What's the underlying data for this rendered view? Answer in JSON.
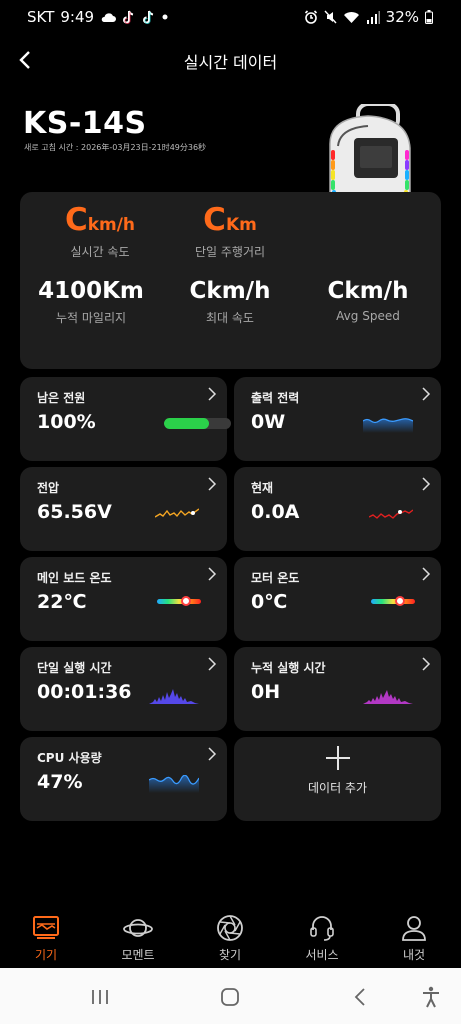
{
  "status_bar": {
    "carrier": "SKT",
    "time": "9:49",
    "battery": "32%"
  },
  "header": {
    "title": "실시간 데이터"
  },
  "device": {
    "model": "KS-14S",
    "refresh_time": "새로 고침 시간 : 2026年-03月23日-21时49分36秒"
  },
  "summary": {
    "speed": {
      "value": "C",
      "unit": "km/h",
      "label": "실시간 속도"
    },
    "trip": {
      "value": "C",
      "unit": "Km",
      "label": "단일 주행거리"
    },
    "mileage": {
      "value": "4100Km",
      "label": "누적 마일리지"
    },
    "max_speed": {
      "value": "Ckm/h",
      "label": "최대 속도"
    },
    "avg_speed": {
      "value": "Ckm/h",
      "label": "Avg Speed"
    }
  },
  "tiles": {
    "battery": {
      "label": "남은 전원",
      "value": "100%",
      "level": 0.67
    },
    "output_power": {
      "label": "출력 전력",
      "value": "0W"
    },
    "voltage": {
      "label": "전압",
      "value": "65.56V"
    },
    "current": {
      "label": "현재",
      "value": "0.0A"
    },
    "board_temp": {
      "label": "메인 보드 온도",
      "value": "22℃",
      "level": 0.67
    },
    "motor_temp": {
      "label": "모터 온도",
      "value": "0℃",
      "level": 0.67
    },
    "trip_time": {
      "label": "단일 실행 시간",
      "value": "00:01:36"
    },
    "total_time": {
      "label": "누적 실행 시간",
      "value": "0H"
    },
    "cpu": {
      "label": "CPU 사용량",
      "value": "47%"
    },
    "add": {
      "label": "데이터 추가"
    }
  },
  "nav": [
    {
      "label": "기기",
      "icon": "dashboard-icon",
      "active": true
    },
    {
      "label": "모멘트",
      "icon": "planet-icon"
    },
    {
      "label": "찾기",
      "icon": "aperture-icon"
    },
    {
      "label": "서비스",
      "icon": "headset-icon"
    },
    {
      "label": "내것",
      "icon": "user-icon"
    }
  ],
  "colors": {
    "accent": "#ff6a1a",
    "card": "#1e1e1e",
    "battery": "#2bd14a"
  }
}
